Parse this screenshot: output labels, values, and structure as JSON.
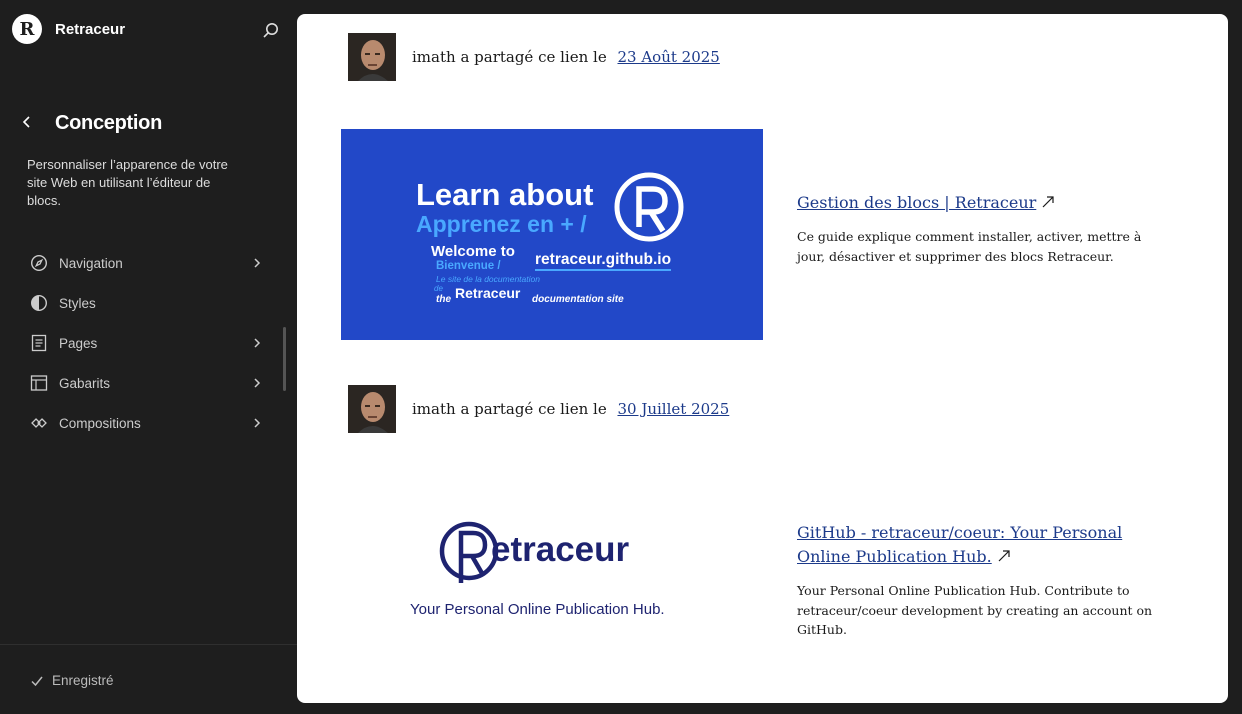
{
  "sidebar": {
    "brand_name": "Retraceur",
    "brand_logo_letter": "R",
    "section_title": "Conception",
    "section_description": "Personnaliser l’apparence de votre site Web en utilisant l’éditeur de blocs.",
    "nav_items": [
      {
        "label": "Navigation",
        "icon": "compass-icon",
        "has_chevron": true
      },
      {
        "label": "Styles",
        "icon": "half-circle-icon",
        "has_chevron": false
      },
      {
        "label": "Pages",
        "icon": "page-icon",
        "has_chevron": true
      },
      {
        "label": "Gabarits",
        "icon": "layout-icon",
        "has_chevron": true
      },
      {
        "label": "Compositions",
        "icon": "diamond-icon",
        "has_chevron": true
      }
    ],
    "status": "Enregistré"
  },
  "posts": [
    {
      "author": "imath",
      "share_text": "a partagé ce lien le",
      "date": "23 Août 2025",
      "image": {
        "line1": "Learn about",
        "line2": "Apprenez en + /",
        "line3": "Welcome to",
        "line4": "Bienvenue /",
        "line5": "Le site de la documentation",
        "line6": "de",
        "line7": "the",
        "line8": "Retraceur",
        "line9": "documentation site",
        "url_text": "retraceur.github.io"
      },
      "link_title": "Gestion des blocs | Retraceur",
      "link_description": "Ce guide explique comment installer, activer, mettre à jour, désactiver et supprimer des blocs Retraceur."
    },
    {
      "author": "imath",
      "share_text": "a partagé ce lien le",
      "date": "30 Juillet 2025",
      "image": {
        "wordmark": "etraceur",
        "tagline": "Your Personal Online Publication Hub."
      },
      "link_title": "GitHub - retraceur/coeur: Your Personal Online Publication Hub.",
      "link_description": "Your Personal Online Publication Hub. Contribute to retraceur/coeur development by creating an account on GitHub."
    }
  ],
  "colors": {
    "sidebar_bg": "#1e1e1e",
    "link": "#1c3a8a",
    "card_blue": "#2248c8",
    "accent_light_blue": "#49a8ff",
    "brand_navy": "#1e2370"
  }
}
